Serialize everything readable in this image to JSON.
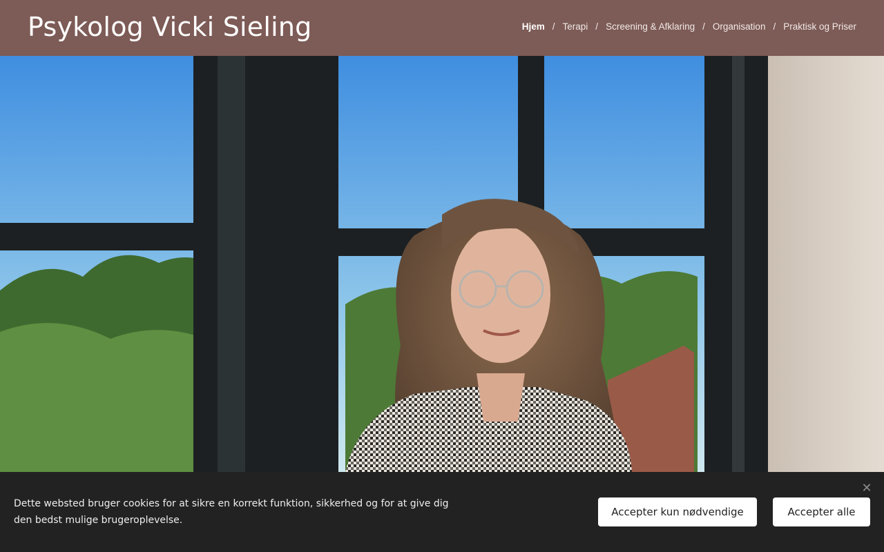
{
  "header": {
    "site_title": "Psykolog Vicki Sieling",
    "nav": [
      {
        "label": "Hjem",
        "active": true
      },
      {
        "label": "Terapi",
        "active": false
      },
      {
        "label": "Screening & Afklaring",
        "active": false
      },
      {
        "label": "Organisation",
        "active": false
      },
      {
        "label": "Praktisk og Priser",
        "active": false
      }
    ],
    "separator": "/"
  },
  "colors": {
    "header_bg": "#7d5b56",
    "cookie_bg": "#222222",
    "button_bg": "#ffffff"
  },
  "cookie_banner": {
    "text": "Dette websted bruger cookies for at sikre en korrekt funktion, sikkerhed og for at give dig den bedst mulige brugeroplevelse.",
    "accept_necessary": "Accepter kun nødvendige",
    "accept_all": "Accepter alle",
    "close_icon": "close-icon"
  }
}
